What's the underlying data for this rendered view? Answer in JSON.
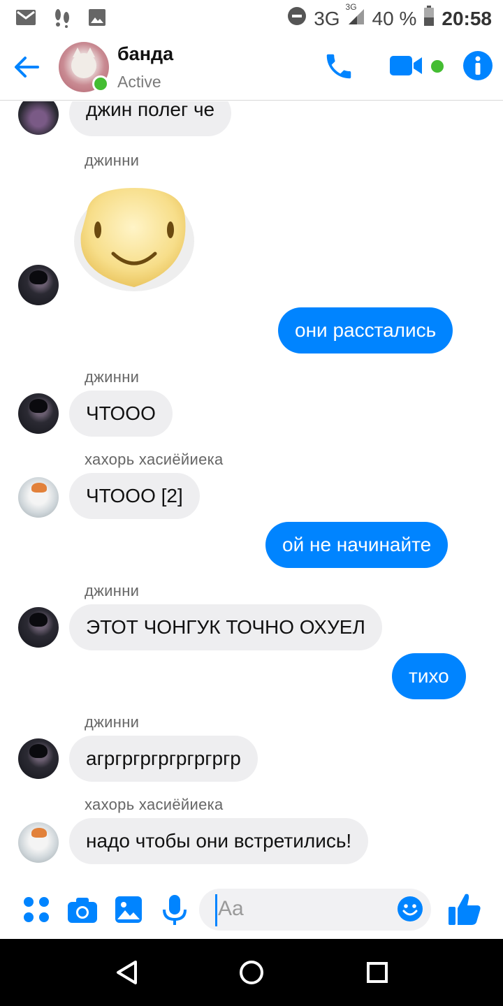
{
  "status_bar": {
    "network": "3G",
    "network_small": "3G",
    "battery": "40 %",
    "time": "20:58",
    "icons": [
      "gmail-icon",
      "footsteps-icon",
      "image-icon",
      "do-not-disturb-icon",
      "signal-icon",
      "battery-icon"
    ]
  },
  "header": {
    "title": "банда",
    "subtitle": "Active",
    "icons": [
      "back-arrow-icon",
      "phone-icon",
      "video-camera-icon",
      "info-icon"
    ]
  },
  "conversation": {
    "top_cut_text": "джин полег че",
    "messages": [
      {
        "type": "sender",
        "text": "джинни"
      },
      {
        "type": "sticker",
        "name": "smiley-face-sticker"
      },
      {
        "type": "outgoing",
        "text": "они расстались"
      },
      {
        "type": "sender",
        "text": "джинни"
      },
      {
        "type": "incoming",
        "text": "ЧТООО"
      },
      {
        "type": "sender",
        "text": "хахорь хасиёйиека"
      },
      {
        "type": "incoming",
        "text": "ЧТООО [2]"
      },
      {
        "type": "outgoing",
        "text": "ой не начинайте"
      },
      {
        "type": "sender",
        "text": "джинни"
      },
      {
        "type": "incoming",
        "text": "ЭТОТ ЧОНГУК ТОЧНО ОХУЕЛ"
      },
      {
        "type": "outgoing",
        "text": "тихо"
      },
      {
        "type": "sender",
        "text": "джинни"
      },
      {
        "type": "incoming",
        "text": "агргргргргргргргр"
      },
      {
        "type": "sender",
        "text": "хахорь хасиёйиека"
      },
      {
        "type": "incoming",
        "text": "надо чтобы они встретились!"
      }
    ]
  },
  "composer": {
    "placeholder": "Aa",
    "icons": [
      "more-apps-icon",
      "camera-icon",
      "gallery-icon",
      "microphone-icon",
      "emoji-icon",
      "thumbs-up-icon"
    ]
  },
  "colors": {
    "accent": "#0084ff",
    "incoming_bubble": "#eeeef0",
    "online": "#44bd32"
  },
  "nav": {
    "icons": [
      "back-triangle-icon",
      "home-circle-icon",
      "recents-square-icon"
    ]
  }
}
